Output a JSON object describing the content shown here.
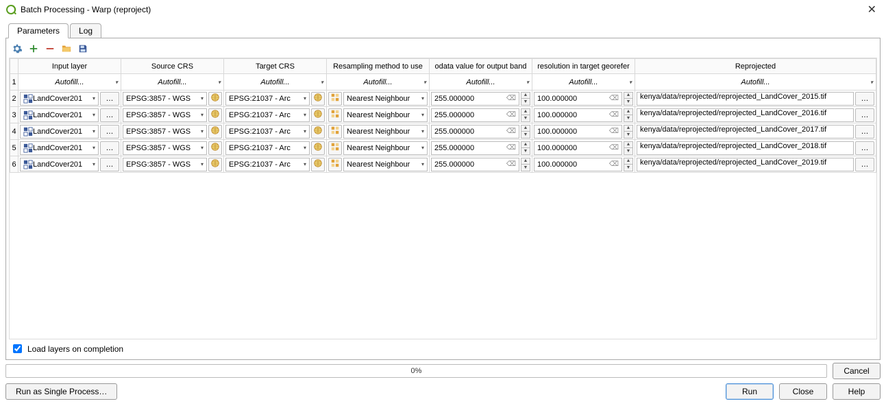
{
  "window": {
    "title": "Batch Processing - Warp (reproject)"
  },
  "tabs": {
    "parameters": "Parameters",
    "log": "Log"
  },
  "columns": {
    "input_layer": "Input layer",
    "source_crs": "Source CRS",
    "target_crs": "Target CRS",
    "resampling": "Resampling method to use",
    "nodata": "odata value for output band",
    "resolution": "resolution in target georefer",
    "reprojected": "Reprojected"
  },
  "autofill_label": "Autofill...",
  "rows": [
    {
      "n": "1",
      "input_layer": "LandCover201",
      "source_crs": "EPSG:3857 - WGS",
      "target_crs": "EPSG:21037 - Arc",
      "resampling": "Nearest Neighbour",
      "nodata": "255.000000",
      "resolution": "100.000000",
      "output": "kenya/data/reprojected/reprojected_LandCover_2015.tif"
    },
    {
      "n": "2",
      "input_layer": "LandCover201",
      "source_crs": "EPSG:3857 - WGS",
      "target_crs": "EPSG:21037 - Arc",
      "resampling": "Nearest Neighbour",
      "nodata": "255.000000",
      "resolution": "100.000000",
      "output": "kenya/data/reprojected/reprojected_LandCover_2016.tif"
    },
    {
      "n": "3",
      "input_layer": "LandCover201",
      "source_crs": "EPSG:3857 - WGS",
      "target_crs": "EPSG:21037 - Arc",
      "resampling": "Nearest Neighbour",
      "nodata": "255.000000",
      "resolution": "100.000000",
      "output": "kenya/data/reprojected/reprojected_LandCover_2017.tif"
    },
    {
      "n": "4",
      "input_layer": "LandCover201",
      "source_crs": "EPSG:3857 - WGS",
      "target_crs": "EPSG:21037 - Arc",
      "resampling": "Nearest Neighbour",
      "nodata": "255.000000",
      "resolution": "100.000000",
      "output": "kenya/data/reprojected/reprojected_LandCover_2018.tif"
    },
    {
      "n": "5",
      "input_layer": "LandCover201",
      "source_crs": "EPSG:3857 - WGS",
      "target_crs": "EPSG:21037 - Arc",
      "resampling": "Nearest Neighbour",
      "nodata": "255.000000",
      "resolution": "100.000000",
      "output": "kenya/data/reprojected/reprojected_LandCover_2019.tif"
    }
  ],
  "checkbox": {
    "load_layers": "Load layers on completion",
    "checked": true
  },
  "progress": {
    "percent": "0%"
  },
  "buttons": {
    "cancel": "Cancel",
    "run_single": "Run as Single Process…",
    "run": "Run",
    "close": "Close",
    "help": "Help",
    "ellipsis": "…"
  }
}
